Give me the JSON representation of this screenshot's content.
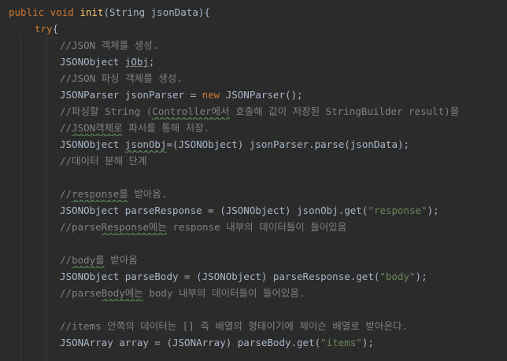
{
  "code": {
    "lines": [
      {
        "kw1": "public void",
        "fn": "init",
        "rest": "(String jsonData){"
      },
      {
        "kw": "try",
        "rest": "{"
      },
      {
        "comment": "//JSON 객체를 생성."
      },
      {
        "type": "JSONObject ",
        "var": "jObj",
        "end": ";"
      },
      {
        "comment": "//JSON 파싱 객체를 생성."
      },
      {
        "a": "JSONParser jsonParser = ",
        "kw": "new",
        "b": " JSONParser();"
      },
      {
        "c1": "//파싱할 String (",
        "c2": "Controller에서",
        "c3": " 호출해 값이 저장된 StringBuilder result)을"
      },
      {
        "c1": "//",
        "c2": "JSON객체로",
        "c3": " 파서를 통해 저장."
      },
      {
        "a": "JSONObject ",
        "b": "jsonObj",
        "c": "=(JSONObject) jsonParser.parse(jsonData);"
      },
      {
        "comment": "//데이터 분해 단계"
      },
      {},
      {
        "c1": "//",
        "c2": "response를",
        "c3": " 받아옴."
      },
      {
        "a": "JSONObject parseResponse = (JSONObject) jsonObj.get(",
        "s": "\"response\"",
        "b": ");"
      },
      {
        "c1": "//parse",
        "c2": "Response에는",
        "c3": " response 내부의 데이터들이 들어있음"
      },
      {},
      {
        "c1": "//",
        "c2": "body를",
        "c3": " 받아옴"
      },
      {
        "a": "JSONObject parseBody = (JSONObject) parseResponse.get(",
        "s": "\"body\"",
        "b": ");"
      },
      {
        "c1": "//parse",
        "c2": "Body에는",
        "c3": " body 내부의 데이터들이 들어있음."
      },
      {},
      {
        "comment": "//items 안쪽의 데이터는 [] 즉 배열의 형태이기에 제이슨 배열로 받아온다."
      },
      {
        "a": "JSONArray array = (JSONArray) parseBody.get(",
        "s": "\"items\"",
        "b": ");"
      }
    ]
  },
  "colors": {
    "background": "#2b2b2b",
    "text": "#a9b7c6",
    "keyword": "#cc7832",
    "function": "#ffc66d",
    "string": "#6a8759",
    "comment": "#808080"
  }
}
